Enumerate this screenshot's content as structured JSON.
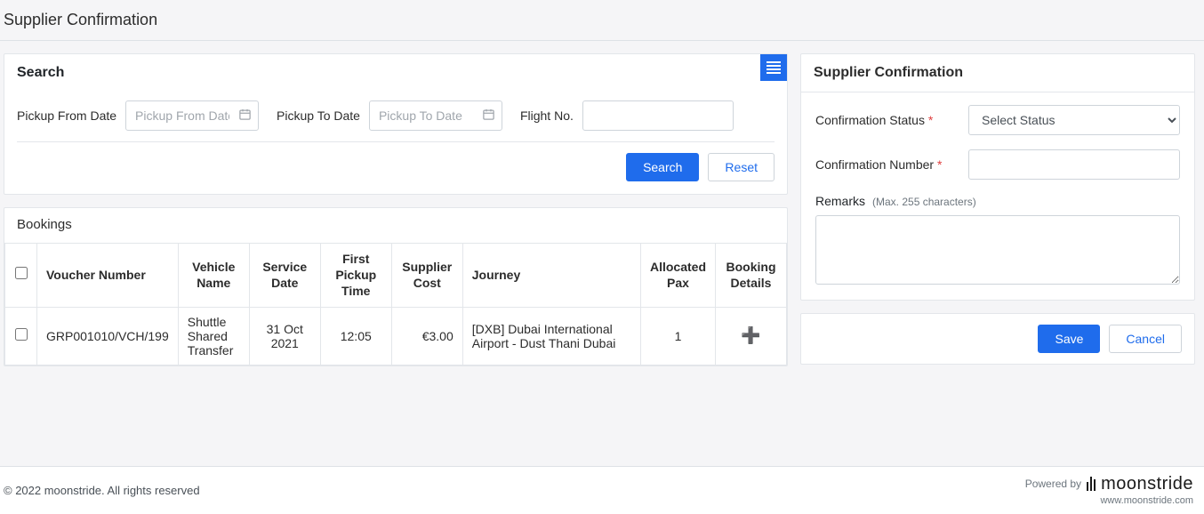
{
  "page": {
    "title": "Supplier Confirmation"
  },
  "search": {
    "title": "Search",
    "pickup_from_label": "Pickup From Date",
    "pickup_from_placeholder": "Pickup From Date",
    "pickup_to_label": "Pickup To Date",
    "pickup_to_placeholder": "Pickup To Date",
    "flight_no_label": "Flight No.",
    "search_btn": "Search",
    "reset_btn": "Reset"
  },
  "bookings": {
    "title": "Bookings",
    "headers": {
      "voucher_number": "Voucher Number",
      "vehicle_name": "Vehicle Name",
      "service_date": "Service Date",
      "first_pickup_time": "First Pickup Time",
      "supplier_cost": "Supplier Cost",
      "journey": "Journey",
      "allocated_pax": "Allocated Pax",
      "booking_details": "Booking Details"
    },
    "rows": [
      {
        "voucher_number": "GRP001010/VCH/199",
        "vehicle_name": "Shuttle Shared Transfer",
        "service_date": "31 Oct 2021",
        "first_pickup_time": "12:05",
        "supplier_cost": "€3.00",
        "journey": "[DXB] Dubai International Airport - Dust Thani Dubai",
        "allocated_pax": "1"
      }
    ]
  },
  "form": {
    "title": "Supplier Confirmation",
    "status_label": "Confirmation Status",
    "status_placeholder": "Select Status",
    "number_label": "Confirmation Number",
    "remarks_label": "Remarks",
    "remarks_hint": "(Max. 255 characters)",
    "save_btn": "Save",
    "cancel_btn": "Cancel"
  },
  "footer": {
    "copyright": "© 2022 moonstride. All rights reserved",
    "powered_by": "Powered by",
    "brand": "moonstride",
    "brand_url": "www.moonstride.com"
  }
}
